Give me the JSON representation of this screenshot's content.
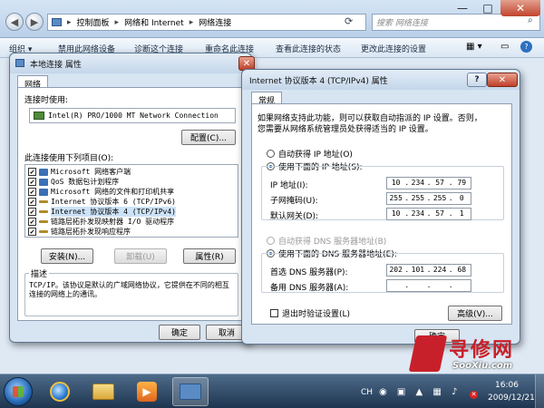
{
  "explorer": {
    "breadcrumb": [
      "控制面板",
      "网络和 Internet",
      "网络连接"
    ],
    "search_placeholder": "搜索 网络连接",
    "commands": [
      "组织 ▾",
      "禁用此网络设备",
      "诊断这个连接",
      "重命名此连接",
      "查看此连接的状态",
      "更改此连接的设置"
    ],
    "window_controls": {
      "minimize": "—",
      "maximize": "□",
      "close": "✕"
    }
  },
  "left_dialog": {
    "title": "本地连接 属性",
    "close": "✕",
    "tab": "网络",
    "connect_using_label": "连接时使用:",
    "adapter": "Intel(R) PRO/1000 MT Network Connection",
    "configure_button": "配置(C)...",
    "items_label": "此连接使用下列项目(O):",
    "items": [
      {
        "label": "Microsoft 网络客户端",
        "checked": "✔",
        "color": "#3b6fb6"
      },
      {
        "label": "QoS 数据包计划程序",
        "checked": "✔",
        "color": "#3b6fb6"
      },
      {
        "label": "Microsoft 网络的文件和打印机共享",
        "checked": "✔",
        "color": "#3b6fb6"
      },
      {
        "label": "Internet 协议版本 6 (TCP/IPv6)",
        "checked": "✔",
        "color": "#b08b2a"
      },
      {
        "label": "Internet 协议版本 4 (TCP/IPv4)",
        "checked": "✔",
        "color": "#b08b2a"
      },
      {
        "label": "链路层拓扑发现映射器 I/O 驱动程序",
        "checked": "✔",
        "color": "#b08b2a"
      },
      {
        "label": "链路层拓扑发现响应程序",
        "checked": "✔",
        "color": "#b08b2a"
      }
    ],
    "install_button": "安装(N)...",
    "uninstall_button": "卸载(U)",
    "properties_button": "属性(R)",
    "description_title": "描述",
    "description": "TCP/IP。该协议是默认的广域网络协议，它提供在不同的相互连接的网络上的通讯。",
    "ok_button": "确定",
    "cancel_button": "取消"
  },
  "right_dialog": {
    "title": "Internet 协议版本 4 (TCP/IPv4) 属性",
    "help": "?",
    "close": "✕",
    "tab": "常规",
    "intro": [
      "如果网络支持此功能，则可以获取自动指派的 IP 设置。否则，",
      "您需要从网络系统管理员处获得适当的 IP 设置。"
    ],
    "auto_ip": "自动获得 IP 地址(O)",
    "manual_ip": "使用下面的 IP 地址(S):",
    "ip_label": "IP 地址(I):",
    "ip": [
      "10",
      "234",
      "57",
      "79"
    ],
    "mask_label": "子网掩码(U):",
    "mask": [
      "255",
      "255",
      "255",
      "0"
    ],
    "gateway_label": "默认网关(D):",
    "gateway": [
      "10",
      "234",
      "57",
      "1"
    ],
    "auto_dns": "自动获得 DNS 服务器地址(B)",
    "manual_dns": "使用下面的 DNS 服务器地址(E):",
    "dns1_label": "首选 DNS 服务器(P):",
    "dns1": [
      "202",
      "101",
      "224",
      "68"
    ],
    "dns2_label": "备用 DNS 服务器(A):",
    "dns2": [
      "",
      "",
      "",
      ""
    ],
    "validate_label": "退出时验证设置(L)",
    "advanced_button": "高级(V)...",
    "ok_button": "确定"
  },
  "watermark": {
    "text": "寻修网",
    "url": "SooXiu.com"
  },
  "taskbar": {
    "lang": "CH",
    "time": "16:06",
    "date": "2009/12/21"
  }
}
